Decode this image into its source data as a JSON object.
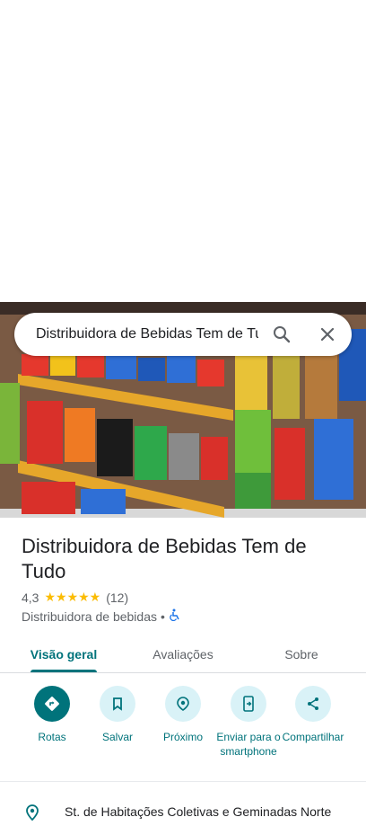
{
  "search": {
    "query": "Distribuidora de Bebidas Tem de Tudo"
  },
  "place": {
    "name": "Distribuidora de Bebidas Tem de Tudo",
    "rating": "4,3",
    "stars": "★★★★★",
    "review_count": "(12)",
    "category": "Distribuidora de bebidas",
    "separator": "•"
  },
  "tabs": [
    {
      "label": "Visão geral",
      "active": true
    },
    {
      "label": "Avaliações",
      "active": false
    },
    {
      "label": "Sobre",
      "active": false
    }
  ],
  "actions": [
    {
      "label": "Rotas",
      "icon": "directions-icon"
    },
    {
      "label": "Salvar",
      "icon": "bookmark-icon"
    },
    {
      "label": "Próximo",
      "icon": "nearby-icon"
    },
    {
      "label": "Enviar para o smartphone",
      "icon": "send-to-phone-icon"
    },
    {
      "label": "Compartilhar",
      "icon": "share-icon"
    }
  ],
  "address": "St. de Habitações Coletivas e Geminadas Norte",
  "colors": {
    "accent": "#00737b",
    "action_bg": "#d9f2f7",
    "star": "#fbbc04"
  }
}
